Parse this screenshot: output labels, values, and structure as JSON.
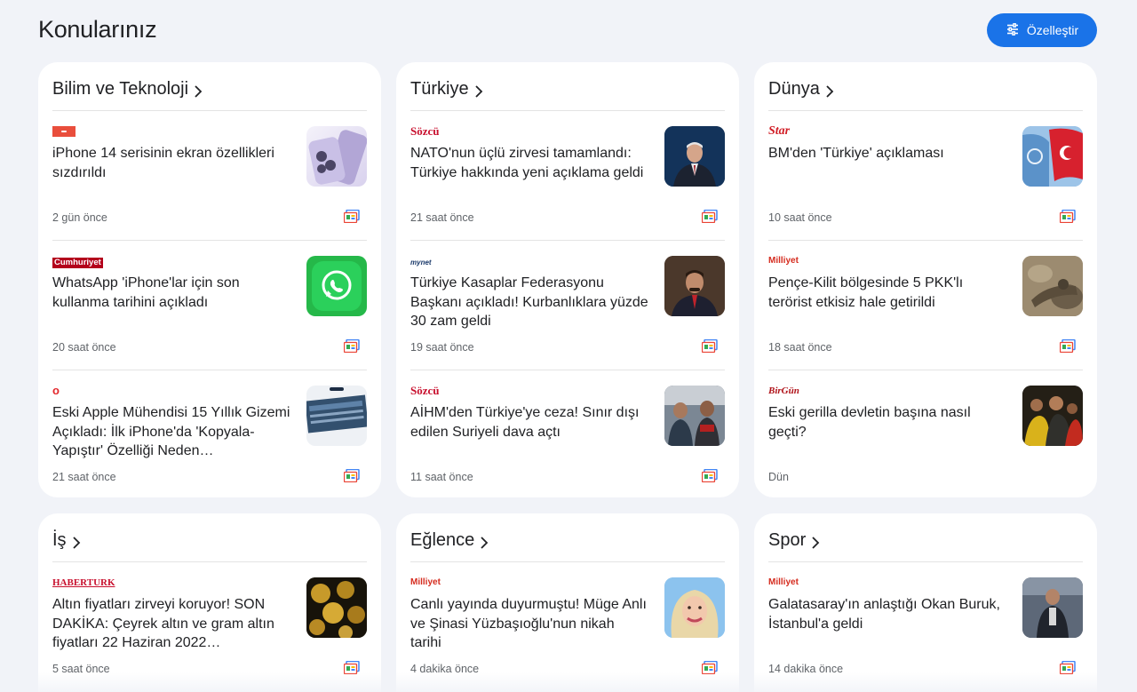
{
  "page": {
    "title": "Konularınız",
    "customize_label": "Özelleştir"
  },
  "colors": {
    "accent": "#1a73e8",
    "background": "#f1f3f8",
    "card": "#ffffff",
    "sozcu": "#c8102e",
    "milliyet": "#d52b1e",
    "haberturk": "#c8102e"
  },
  "icons": {
    "customize": "tune-icon",
    "chevron": "chevron-right-icon",
    "full_coverage": "full-coverage-icon"
  },
  "sections": [
    {
      "title": "Bilim ve Teknoloji",
      "stories": [
        {
          "source": "",
          "source_style": "flag",
          "headline": "iPhone 14 serisinin ekran özellikleri sızdırıldı",
          "time": "2 gün önce",
          "thumb": "iphone"
        },
        {
          "source": "Cumhuriyet",
          "source_style": "box",
          "headline": "WhatsApp 'iPhone'lar için son kullanma tarihini açıkladı",
          "time": "20 saat önce",
          "thumb": "whatsapp"
        },
        {
          "source": "o",
          "source_style": "circle",
          "headline": "Eski Apple Mühendisi 15 Yıllık Gizemi Açıkladı: İlk iPhone'da 'Kopyala-Yapıştır' Özelliği Neden…",
          "time": "21 saat önce",
          "thumb": "screen"
        }
      ]
    },
    {
      "title": "Türkiye",
      "stories": [
        {
          "source": "Sözcü",
          "source_style": "serif-red",
          "headline": "NATO'nun üçlü zirvesi tamamlandı: Türkiye hakkında yeni açıklama geldi",
          "time": "21 saat önce",
          "thumb": "suit"
        },
        {
          "source": "mynet",
          "source_style": "small",
          "headline": "Türkiye Kasaplar Federasyonu Başkanı açıkladı! Kurbanlıklara yüzde 30 zam geldi",
          "time": "19 saat önce",
          "thumb": "man"
        },
        {
          "source": "Sözcü",
          "source_style": "serif-red",
          "headline": "AİHM'den Türkiye'ye ceza! Sınır dışı edilen Suriyeli dava açtı",
          "time": "11 saat önce",
          "thumb": "crowd"
        }
      ]
    },
    {
      "title": "Dünya",
      "stories": [
        {
          "source": "Star",
          "source_style": "serif-red",
          "headline": "BM'den 'Türkiye' açıklaması",
          "time": "10 saat önce",
          "thumb": "flags"
        },
        {
          "source": "Milliyet",
          "source_style": "milliyet",
          "headline": "Pençe-Kilit bölgesinde 5 PKK'lı terörist etkisiz hale getirildi",
          "time": "18 saat önce",
          "thumb": "soldier"
        },
        {
          "source": "BirGün",
          "source_style": "birgun",
          "headline": "Eski gerilla devletin başına nasıl geçti?",
          "time": "Dün",
          "thumb": "rally"
        }
      ]
    },
    {
      "title": "İş",
      "stories": [
        {
          "source": "HABERTURK",
          "source_style": "haberturk",
          "headline": "Altın fiyatları zirveyi koruyor! SON DAKİKA: Çeyrek altın ve gram altın fiyatları 22 Haziran 2022…",
          "time": "5 saat önce",
          "thumb": "gold"
        }
      ]
    },
    {
      "title": "Eğlence",
      "stories": [
        {
          "source": "Milliyet",
          "source_style": "milliyet",
          "headline": "Canlı yayında duyurmuştu! Müge Anlı ve Şinasi Yüzbaşıoğlu'nun nikah tarihi",
          "time": "4 dakika önce",
          "thumb": "woman"
        }
      ]
    },
    {
      "title": "Spor",
      "stories": [
        {
          "source": "Milliyet",
          "source_style": "milliyet",
          "headline": "Galatasaray'ın anlaştığı Okan Buruk, İstanbul'a geldi",
          "time": "14 dakika önce",
          "thumb": "airport"
        }
      ]
    }
  ]
}
